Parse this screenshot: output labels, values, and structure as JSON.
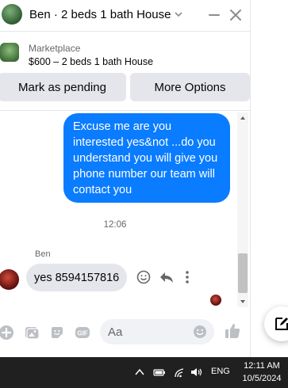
{
  "header": {
    "title": "Ben · 2 beds 1 bath House"
  },
  "listing": {
    "source": "Marketplace",
    "summary": "$600 – 2 beds 1 bath House"
  },
  "actions": {
    "pending_label": "Mark as pending",
    "more_label": "More Options"
  },
  "conversation": {
    "outgoing_text": "Excuse me are you interested yes&not ...do you understand you will give you phone number our team will contact you",
    "timestamp": "12:06",
    "incoming_sender": "Ben",
    "incoming_text": "yes 8594157816"
  },
  "composer": {
    "placeholder": "Aa",
    "icons": [
      "plus-icon",
      "image-icon",
      "sticker-icon",
      "gif-icon",
      "emoji-icon",
      "like-icon"
    ]
  },
  "taskbar": {
    "language": "ENG",
    "time": "12:11 AM",
    "date": "10/5/2024"
  },
  "colors": {
    "outgoing_bubble": "#0a7cff",
    "incoming_bubble": "#e4e6eb",
    "accent_icon": "#0a7cff",
    "taskbar": "#202020"
  }
}
